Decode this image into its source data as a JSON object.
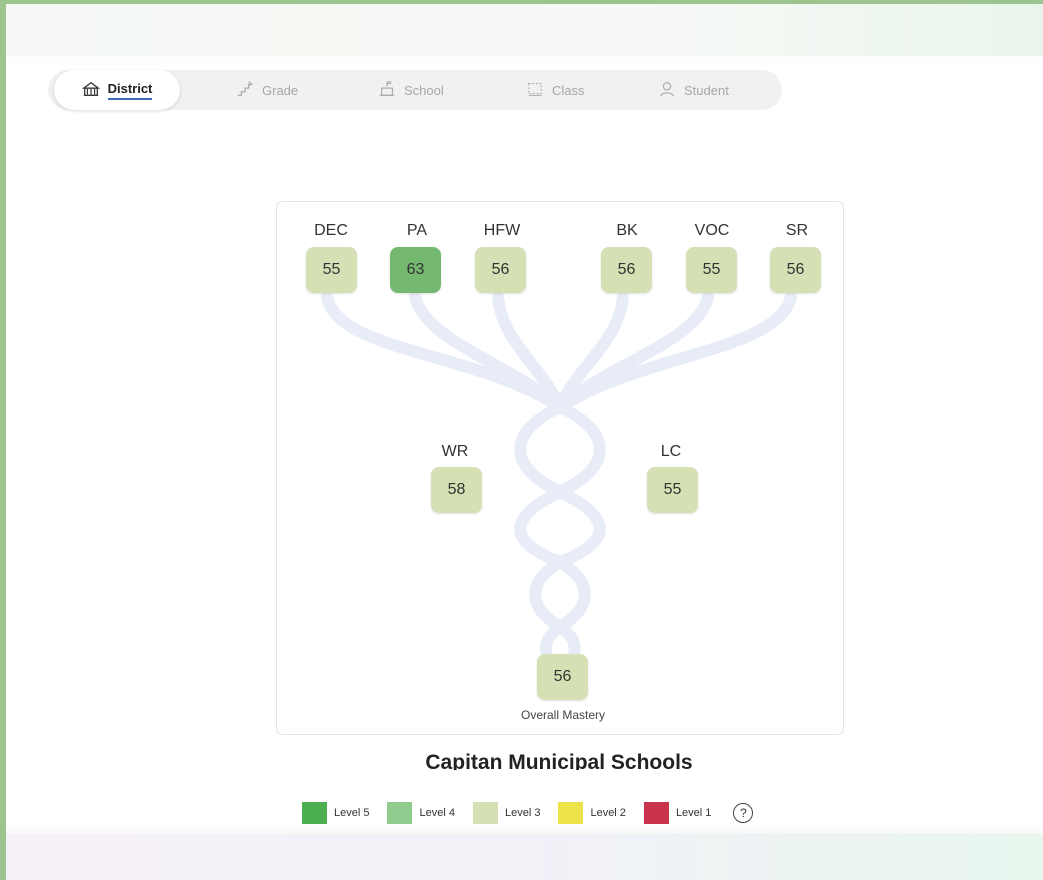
{
  "tabs": [
    {
      "label": "District",
      "icon": "district-building-icon",
      "active": true
    },
    {
      "label": "Grade",
      "icon": "grade-stairs-icon",
      "active": false
    },
    {
      "label": "School",
      "icon": "school-icon",
      "active": false
    },
    {
      "label": "Class",
      "icon": "class-icon",
      "active": false
    },
    {
      "label": "Student",
      "icon": "student-person-icon",
      "active": false
    }
  ],
  "tree": {
    "top_nodes": [
      {
        "label": "DEC",
        "score": "55",
        "level": 3
      },
      {
        "label": "PA",
        "score": "63",
        "level": 4
      },
      {
        "label": "HFW",
        "score": "56",
        "level": 3
      },
      {
        "label": "BK",
        "score": "56",
        "level": 3
      },
      {
        "label": "VOC",
        "score": "55",
        "level": 3
      },
      {
        "label": "SR",
        "score": "56",
        "level": 3
      }
    ],
    "mid_nodes": [
      {
        "label": "WR",
        "score": "58",
        "level": 3
      },
      {
        "label": "LC",
        "score": "55",
        "level": 3
      }
    ],
    "overall": {
      "score": "56",
      "caption": "Overall Mastery",
      "level": 3
    }
  },
  "school_name": "Capitan Municipal Schools",
  "legend": [
    {
      "label": "Level 5",
      "color": "#4caf50"
    },
    {
      "label": "Level 4",
      "color": "#8fcb8c"
    },
    {
      "label": "Level 3",
      "color": "#d5e0b5"
    },
    {
      "label": "Level 2",
      "color": "#eee24a"
    },
    {
      "label": "Level 1",
      "color": "#c9334b"
    }
  ],
  "help_label": "?",
  "colors": {
    "level3": "#d5e0b5",
    "level4": "#74b96f",
    "branch": "#e6ebf7",
    "active_underline": "#3a6bb8"
  }
}
